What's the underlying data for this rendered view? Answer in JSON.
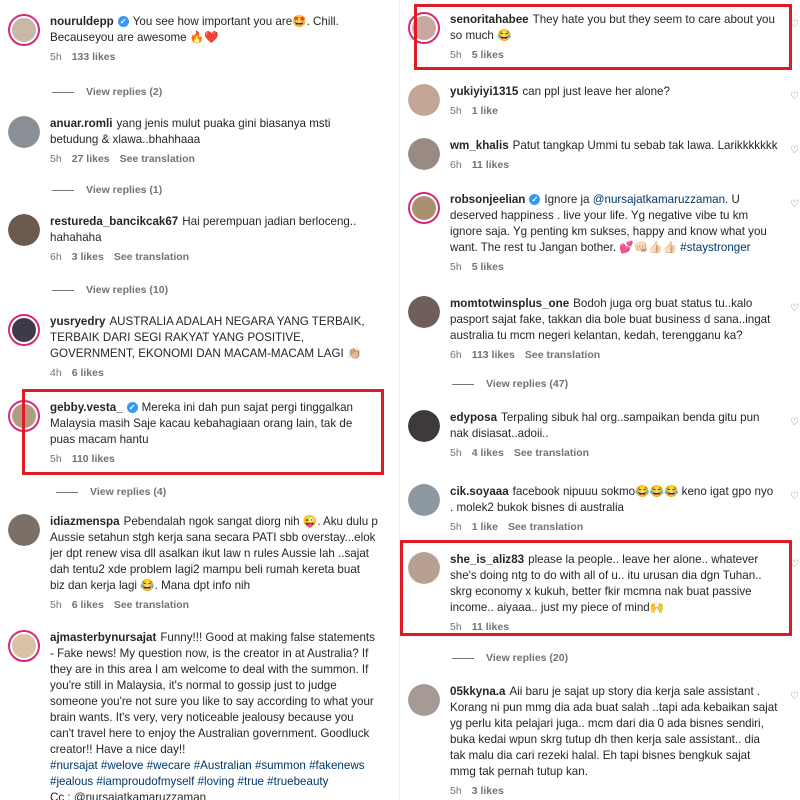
{
  "left_comments": [
    {
      "user": "nouruldepp",
      "verified": true,
      "text": "You see how important you are🤩. Chill. Becauseyou are awesome 🔥❤️",
      "time": "5h",
      "likes": "133 likes",
      "see_translation": "",
      "replies": "View replies (2)",
      "avatar_color": "#c9b7a8"
    },
    {
      "user": "anuar.romli",
      "verified": false,
      "text": "yang jenis mulut puaka gini biasanya msti betudung & xlawa..bhahhaaa",
      "time": "5h",
      "likes": "27 likes",
      "see_translation": "See translation",
      "replies": "View replies (1)",
      "avatar_color": "#8a8f96"
    },
    {
      "user": "restureda_bancikcak67",
      "verified": false,
      "text": "Hai perempuan jadian berloceng.. hahahaha",
      "time": "6h",
      "likes": "3 likes",
      "see_translation": "See translation",
      "replies": "View replies (10)",
      "avatar_color": "#6b5a4e"
    },
    {
      "user": "yusryedry",
      "verified": false,
      "text": "AUSTRALIA ADALAH NEGARA YANG TERBAIK, TERBAIK DARI SEGI RAKYAT YANG POSITIVE, GOVERNMENT, EKONOMI DAN MACAM-MACAM LAGI 👏🏼",
      "time": "4h",
      "likes": "6 likes",
      "see_translation": "",
      "replies": "",
      "avatar_color": "#3f3a4a"
    },
    {
      "user": "gebby.vesta_",
      "verified": true,
      "text": "Mereka ini dah pun sajat pergi tinggalkan Malaysia masih Saje kacau kebahagiaan orang lain, tak de puas macam hantu",
      "time": "5h",
      "likes": "110 likes",
      "see_translation": "",
      "replies": "View replies (4)",
      "avatar_color": "#b39a82"
    },
    {
      "user": "idiazmenspa",
      "verified": false,
      "text": "Pebendalah ngok sangat diorg nih 😜. Aku dulu p Aussie setahun stgh kerja sana secara PATI sbb overstay...elok jer dpt renew visa dll asalkan ikut law n rules Aussie lah ..sajat dah tentu2 xde problem lagi2 mampu beli rumah kereta buat biz dan kerja lagi 😂. Mana dpt info nih",
      "time": "5h",
      "likes": "6 likes",
      "see_translation": "See translation",
      "replies": "",
      "avatar_color": "#7b6f66"
    },
    {
      "user": "ajmasterbynursajat",
      "verified": false,
      "text": "Funny!!! Good at making false statements - Fake news! My question now, is the creator in at Australia? If they are in this area I am welcome to deal with the summon. If you're still in Malaysia, it's normal to gossip just to judge someone you're not sure you like to say according to what your brain wants. It's very, very noticeable jealousy because you can't travel here to enjoy the Australian government. Goodluck creator!! Have a nice day!!",
      "tags": "#nursajat #welove #wecare #Australian #summon #fakenews #jealous #iamproudofmyself #loving #true #truebeauty",
      "cc": "Cc : @nursajatkamaruzzaman",
      "time": "",
      "likes": "",
      "see_translation": "",
      "replies": "",
      "avatar_color": "#d9c2a6"
    }
  ],
  "right_comments": [
    {
      "user": "senoritahabee",
      "verified": false,
      "text": "They hate you but they seem to care about you so much 😂",
      "time": "5h",
      "likes": "5 likes",
      "see_translation": "",
      "replies": "",
      "avatar_color": "#c7a9a0"
    },
    {
      "user": "yukiyiyi1315",
      "verified": false,
      "text": "can ppl just leave her alone?",
      "time": "5h",
      "likes": "1 like",
      "see_translation": "",
      "replies": "",
      "avatar_color": "#c4a696"
    },
    {
      "user": "wm_khalis",
      "verified": false,
      "text": "Patut tangkap Ummi tu sebab tak lawa. Larikkkkkkk",
      "time": "6h",
      "likes": "11 likes",
      "see_translation": "",
      "replies": "",
      "avatar_color": "#9a8b82"
    },
    {
      "user": "robsonjeelian",
      "verified": true,
      "text": "Ignore ja",
      "mention": "@nursajatkamaruzzaman",
      "text2": ". U deserved happiness . live your life. Yg negative vibe tu km ignore saja. Yg penting km sukses, happy and know what you want. The rest tu Jangan bother. 💕👊🏻👍🏻👍🏻",
      "tag": "#staystronger",
      "time": "5h",
      "likes": "5 likes",
      "see_translation": "",
      "replies": "",
      "avatar_color": "#a89070"
    },
    {
      "user": "momtotwinsplus_one",
      "verified": false,
      "text": "Bodoh juga org buat status tu..kalo pasport sajat fake, takkan dia bole buat business d sana..ingat australia tu mcm negeri kelantan, kedah, terengganu ka?",
      "time": "6h",
      "likes": "113 likes",
      "see_translation": "See translation",
      "replies": "View replies (47)",
      "avatar_color": "#6f5f5a"
    },
    {
      "user": "edyposa",
      "verified": false,
      "text": "Terpaling sibuk hal org..sampaikan benda gitu pun nak disiasat..adoii..",
      "time": "5h",
      "likes": "4 likes",
      "see_translation": "See translation",
      "replies": "",
      "avatar_color": "#3e3a3a"
    },
    {
      "user": "cik.soyaaa",
      "verified": false,
      "text": "facebook nipuuu sokmo😂😂😂 keno igat gpo nyo . molek2 bukok bisnes di australia",
      "time": "5h",
      "likes": "1 like",
      "see_translation": "See translation",
      "replies": "",
      "avatar_color": "#8d98a2"
    },
    {
      "user": "she_is_aliz83",
      "verified": false,
      "text": "please la people.. leave her alone.. whatever she's doing ntg to do with all of u.. itu urusan dia dgn Tuhan.. skrg economy x kukuh, better fkir mcmna nak buat passive income.. aiyaaa.. just my piece of mind🙌",
      "time": "5h",
      "likes": "11 likes",
      "see_translation": "",
      "replies": "View replies (20)",
      "avatar_color": "#b7a08f"
    },
    {
      "user": "05kkyna.a",
      "verified": false,
      "text": "Aii baru je sajat up story dia kerja sale assistant . Korang ni pun mmg dia ada buat salah ..tapi ada kebaikan sajat yg perlu kita pelajari juga.. mcm dari dia 0 ada bisnes sendiri, buka kedai wpun skrg tutup dh then kerja sale assistant.. dia tak malu dia cari rezeki halal. Eh tapi bisnes bengkuk sajat mmg tak pernah tutup kan.",
      "time": "5h",
      "likes": "3 likes",
      "see_translation": "",
      "replies": "",
      "avatar_color": "#a59a94"
    }
  ],
  "icons": {
    "heart": "heart-outline-icon",
    "verified": "verified-badge-icon"
  },
  "colors": {
    "highlight": "#e01b24",
    "link": "#00376b",
    "meta": "#737373",
    "verified": "#3897f0"
  }
}
